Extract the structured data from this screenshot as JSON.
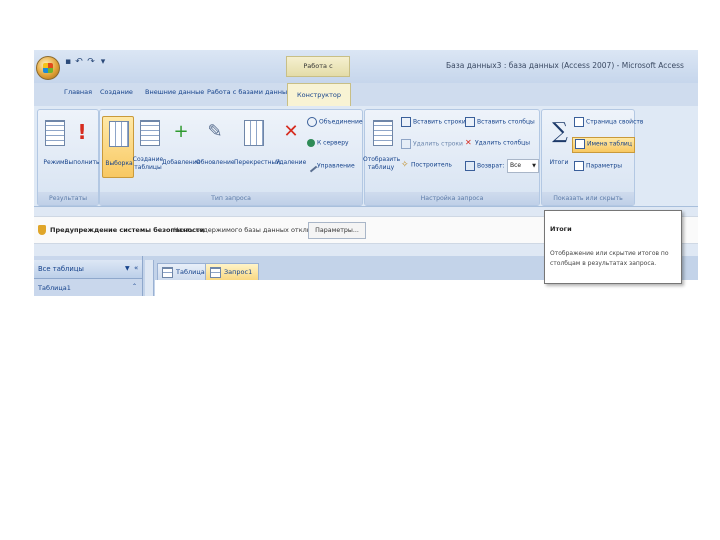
{
  "window": {
    "contextual_group": "Работа с запросами",
    "title": "База данных3 : база данных (Access 2007) - Microsoft Access"
  },
  "quick_access": [
    "save-icon",
    "undo-icon",
    "redo-icon",
    "customize-icon"
  ],
  "tabs": [
    "Главная",
    "Создание",
    "Внешние данные",
    "Работа с базами данных",
    "Конструктор"
  ],
  "active_tab": "Конструктор",
  "ribbon": {
    "results": {
      "label": "Результаты",
      "view": "Режим",
      "run": "Выполнить"
    },
    "query_type": {
      "label": "Тип запроса",
      "select": "Выборка",
      "make_table": "Создание таблицы",
      "append": "Добавление",
      "update": "Обновление",
      "crosstab": "Перекрестный",
      "delete": "Удаление",
      "union": "Объединение",
      "pass_through": "К серверу",
      "data_definition": "Управление"
    },
    "query_setup": {
      "label": "Настройка запроса",
      "show_table": "Отобразить таблицу",
      "insert_rows": "Вставить строки",
      "delete_rows": "Удалить строки",
      "builder": "Построитель",
      "insert_columns": "Вставить столбцы",
      "delete_columns": "Удалить столбцы",
      "return": "Возврат:",
      "return_value": "Все"
    },
    "show_hide": {
      "label": "Показать или скрыть",
      "totals": "Итоги",
      "property_sheet": "Страница свойств",
      "table_names": "Имена таблиц",
      "parameters": "Параметры"
    }
  },
  "message_bar": {
    "title": "Предупреждение системы безопасности",
    "text": "Часть содержимого базы данных отключена",
    "button": "Параметры..."
  },
  "tooltip": {
    "title": "Итоги",
    "body": "Отображение или скрытие итогов по столбцам в результатах запроса."
  },
  "nav_pane": {
    "title": "Все таблицы",
    "group": "Таблица1"
  },
  "doc_tabs": [
    "Таблица1",
    "Запрос1"
  ],
  "active_doc_tab": "Запрос1",
  "colors": {
    "ribbon": "#dfe9f5",
    "accent_selected": "#f8c862",
    "text": "#15428b"
  }
}
